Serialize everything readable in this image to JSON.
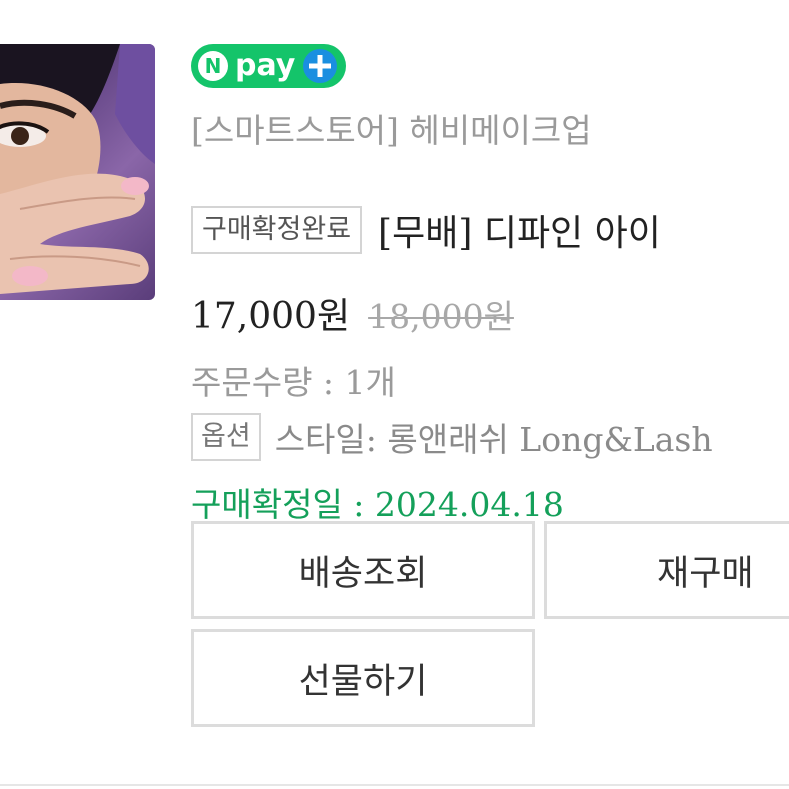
{
  "thumbnail": {
    "alt_icon": "product-photo"
  },
  "badge": {
    "n_letter": "N",
    "text": "pay",
    "plus_icon": "plus-icon",
    "color": "#14c46a"
  },
  "store_name": "[스마트스토어] 헤비메이크업",
  "status_tag": "구매확정완료",
  "product_name": "[무배] 디파인 아이",
  "price": "17,000원",
  "original_price": "18,000원",
  "quantity": "주문수량 : 1개",
  "option": {
    "tag": "옵션",
    "text": "스타일: 롱앤래쉬 Long&Lash"
  },
  "confirm_date": "구매확정일 : 2024.04.18",
  "confirm_color": "#14a05a",
  "buttons": {
    "track": "배송조회",
    "rebuy": "재구매",
    "gift": "선물하기"
  }
}
